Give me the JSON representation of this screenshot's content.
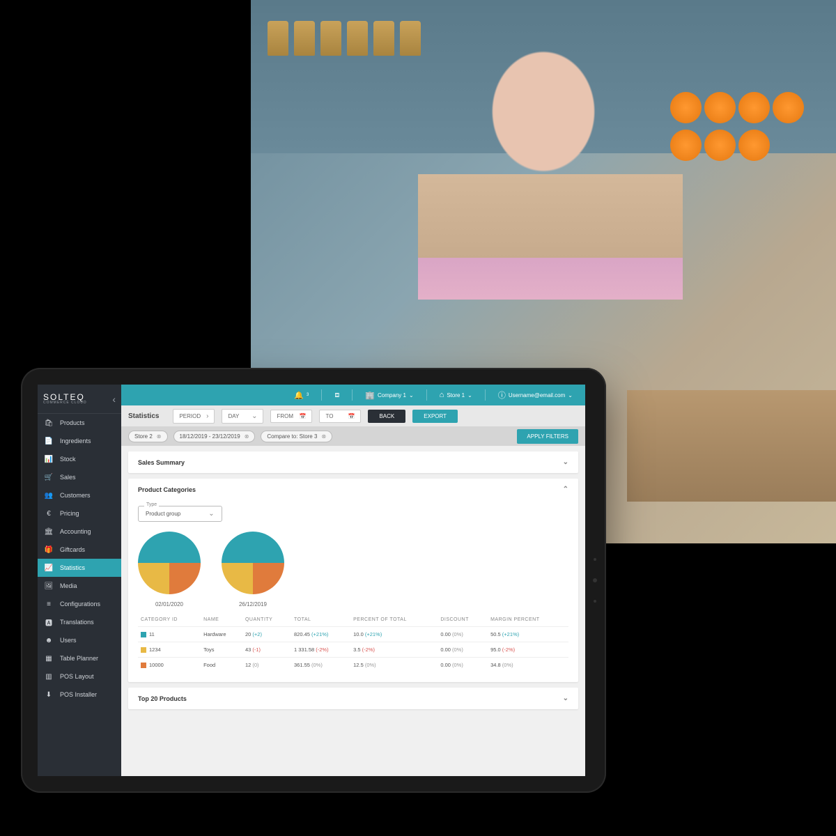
{
  "brand": {
    "name": "SOLTEQ",
    "tagline": "COMMERCE CLOUD"
  },
  "sidebar": {
    "items": [
      {
        "label": "Products",
        "icon": "bag-icon"
      },
      {
        "label": "Ingredients",
        "icon": "note-icon"
      },
      {
        "label": "Stock",
        "icon": "bars-icon"
      },
      {
        "label": "Sales",
        "icon": "cart-icon"
      },
      {
        "label": "Customers",
        "icon": "people-icon"
      },
      {
        "label": "Pricing",
        "icon": "euro-icon"
      },
      {
        "label": "Accounting",
        "icon": "bank-icon"
      },
      {
        "label": "Giftcards",
        "icon": "gift-icon"
      },
      {
        "label": "Statistics",
        "icon": "chart-icon",
        "active": true
      },
      {
        "label": "Media",
        "icon": "image-icon"
      },
      {
        "label": "Configurations",
        "icon": "sliders-icon"
      },
      {
        "label": "Translations",
        "icon": "translate-icon"
      },
      {
        "label": "Users",
        "icon": "user-icon"
      },
      {
        "label": "Table Planner",
        "icon": "table-icon"
      },
      {
        "label": "POS Layout",
        "icon": "layout-icon"
      },
      {
        "label": "POS Installer",
        "icon": "download-icon"
      }
    ]
  },
  "topbar": {
    "notif_badge": "3",
    "company": "Company 1",
    "store": "Store 1",
    "user": "Username@email.com"
  },
  "filters": {
    "title": "Statistics",
    "period": "PERIOD",
    "day": "DAY",
    "from": "FROM",
    "to": "TO",
    "back": "BACK",
    "export": "EXPORT"
  },
  "chips": {
    "store": "Store 2",
    "range": "18/12/2019 - 23/12/2019",
    "compare": "Compare to: Store 3",
    "apply": "APPLY FILTERS"
  },
  "panels": {
    "sales_summary": "Sales Summary",
    "product_categories": "Product Categories",
    "top20": "Top 20 Products",
    "type_label": "Type",
    "type_value": "Product group"
  },
  "pie_labels": {
    "left": "02/01/2020",
    "right": "26/12/2019"
  },
  "table": {
    "headers": [
      "CATEGORY ID",
      "NAME",
      "QUANTITY",
      "TOTAL",
      "PERCENT OF TOTAL",
      "DISCOUNT",
      "MARGIN PERCENT"
    ],
    "rows": [
      {
        "color": "#2ea3b0",
        "id": "11",
        "name": "Hardware",
        "qty": "20",
        "qty_d": "(+2)",
        "qty_c": "pos",
        "total": "820.45",
        "total_d": "(+21%)",
        "total_c": "pos",
        "pct": "10.0",
        "pct_d": "(+21%)",
        "pct_c": "pos",
        "disc": "0.00",
        "disc_d": "(0%)",
        "disc_c": "zero",
        "margin": "50.5",
        "margin_d": "(+21%)",
        "margin_c": "pos"
      },
      {
        "color": "#e8b945",
        "id": "1234",
        "name": "Toys",
        "qty": "43",
        "qty_d": "(-1)",
        "qty_c": "neg",
        "total": "1 331.58",
        "total_d": "(-2%)",
        "total_c": "neg",
        "pct": "3.5",
        "pct_d": "(-2%)",
        "pct_c": "neg",
        "disc": "0.00",
        "disc_d": "(0%)",
        "disc_c": "zero",
        "margin": "95.0",
        "margin_d": "(-2%)",
        "margin_c": "neg"
      },
      {
        "color": "#e07b3c",
        "id": "10000",
        "name": "Food",
        "qty": "12",
        "qty_d": "(0)",
        "qty_c": "zero",
        "total": "361.55",
        "total_d": "(0%)",
        "total_c": "zero",
        "pct": "12.5",
        "pct_d": "(0%)",
        "pct_c": "zero",
        "disc": "0.00",
        "disc_d": "(0%)",
        "disc_c": "zero",
        "margin": "34.8",
        "margin_d": "(0%)",
        "margin_c": "zero"
      }
    ]
  },
  "chart_data": [
    {
      "type": "pie",
      "title": "02/01/2020",
      "series": [
        {
          "name": "Hardware",
          "value": 50,
          "color": "#2ea3b0"
        },
        {
          "name": "Food",
          "value": 25,
          "color": "#e07b3c"
        },
        {
          "name": "Toys",
          "value": 25,
          "color": "#e8b945"
        }
      ]
    },
    {
      "type": "pie",
      "title": "26/12/2019",
      "series": [
        {
          "name": "Hardware",
          "value": 50,
          "color": "#2ea3b0"
        },
        {
          "name": "Food",
          "value": 25,
          "color": "#e07b3c"
        },
        {
          "name": "Toys",
          "value": 25,
          "color": "#e8b945"
        }
      ]
    }
  ],
  "colors": {
    "teal": "#2ea3b0",
    "yellow": "#e8b945",
    "orange": "#e07b3c",
    "sidebar": "#2a2f36"
  }
}
